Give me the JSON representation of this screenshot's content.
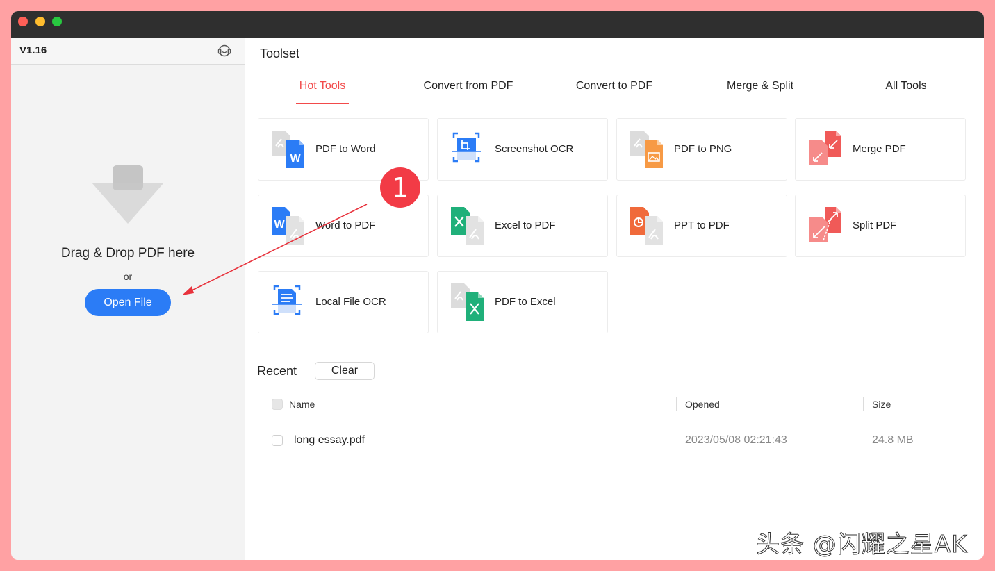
{
  "sidebar": {
    "version": "V1.16",
    "support_icon": "headset-icon",
    "drop_icon": "download-arrow-icon",
    "drop_text": "Drag & Drop PDF here",
    "or_text": "or",
    "open_file_label": "Open File"
  },
  "main": {
    "title": "Toolset",
    "tabs": [
      {
        "label": "Hot Tools",
        "active": true
      },
      {
        "label": "Convert from PDF",
        "active": false
      },
      {
        "label": "Convert to PDF",
        "active": false
      },
      {
        "label": "Merge & Split",
        "active": false
      },
      {
        "label": "All Tools",
        "active": false
      }
    ],
    "tools": [
      {
        "label": "PDF to Word",
        "icon": "pdf-to-word-icon"
      },
      {
        "label": "Screenshot OCR",
        "icon": "screenshot-ocr-icon"
      },
      {
        "label": "PDF to PNG",
        "icon": "pdf-to-png-icon"
      },
      {
        "label": "Merge PDF",
        "icon": "merge-pdf-icon"
      },
      {
        "label": "Word to PDF",
        "icon": "word-to-pdf-icon"
      },
      {
        "label": "Excel to PDF",
        "icon": "excel-to-pdf-icon"
      },
      {
        "label": "PPT to PDF",
        "icon": "ppt-to-pdf-icon"
      },
      {
        "label": "Split PDF",
        "icon": "split-pdf-icon"
      },
      {
        "label": "Local File OCR",
        "icon": "local-file-ocr-icon"
      },
      {
        "label": "PDF to Excel",
        "icon": "pdf-to-excel-icon"
      }
    ]
  },
  "recent": {
    "title": "Recent",
    "clear_label": "Clear",
    "columns": {
      "name": "Name",
      "opened": "Opened",
      "size": "Size"
    },
    "rows": [
      {
        "name": "long essay.pdf",
        "opened": "2023/05/08 02:21:43",
        "size": "24.8 MB"
      }
    ]
  },
  "annotation": {
    "step": "1"
  },
  "watermark": "头条 @闪耀之星AK",
  "colors": {
    "accent": "#2b7cf6",
    "active_tab": "#f24a4a",
    "badge": "#f23b46",
    "background_frame": "#ffa1a3",
    "word_blue": "#2b7cf6",
    "excel_green": "#20b07a",
    "ppt_orange": "#f06a3b",
    "png_orange": "#f79a45",
    "merge_red": "#f05a58"
  }
}
